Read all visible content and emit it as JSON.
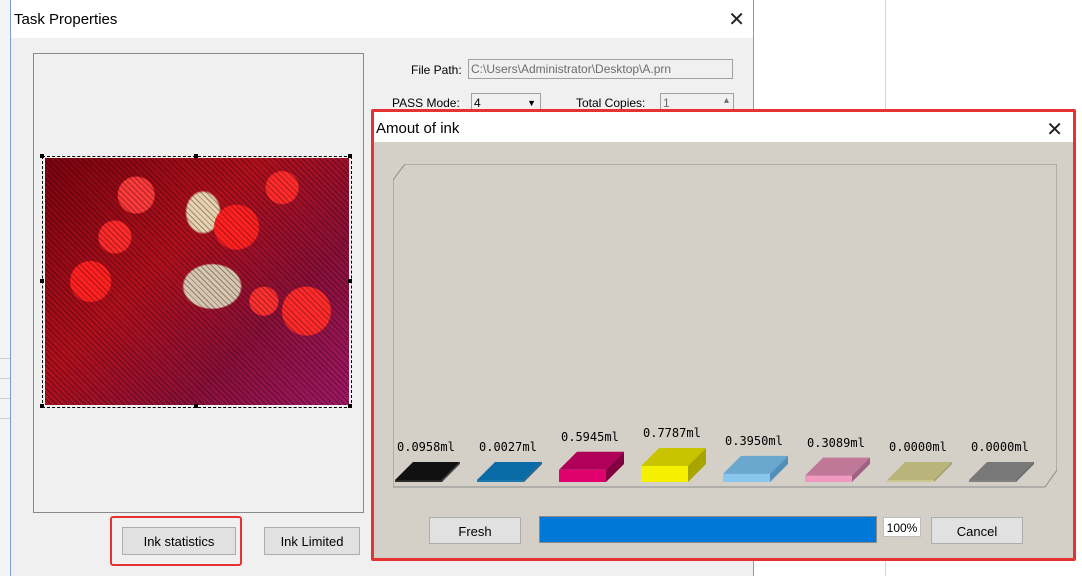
{
  "task_window": {
    "title": "Task Properties",
    "close": "✕",
    "file_path_label": "File Path:",
    "file_path_value": "C:\\Users\\Administrator\\Desktop\\A.prn",
    "pass_mode_label": "PASS Mode:",
    "pass_mode_value": "4",
    "total_copies_label": "Total Copies:",
    "total_copies_value": "1",
    "ink_statistics_button": "Ink statistics",
    "ink_limited_button": "Ink Limited"
  },
  "ink_dialog": {
    "title": "Amout of ink",
    "close": "✕",
    "fresh_button": "Fresh",
    "progress_percent": "100%",
    "progress_value": 1.0,
    "cancel_button": "Cancel"
  },
  "chart_data": {
    "type": "bar",
    "categories": [
      "Black",
      "Cyan",
      "Magenta",
      "Yellow",
      "Light Cyan",
      "Light Magenta",
      "Light Yellow",
      "Gray"
    ],
    "value_labels": [
      "0.0958ml",
      "0.0027ml",
      "0.5945ml",
      "0.7787ml",
      "0.3950ml",
      "0.3089ml",
      "0.0000ml",
      "0.0000ml"
    ],
    "values": [
      0.0958,
      0.0027,
      0.5945,
      0.7787,
      0.395,
      0.3089,
      0.0,
      0.0
    ],
    "colors": [
      {
        "front": "#2a2a2a",
        "top": "#111111",
        "side": "#444444"
      },
      {
        "front": "#1a7ab0",
        "top": "#0a6aa5",
        "side": "#2a5a80"
      },
      {
        "front": "#e0006e",
        "top": "#b0005a",
        "side": "#800040"
      },
      {
        "front": "#f5f000",
        "top": "#c8c400",
        "side": "#a8a400"
      },
      {
        "front": "#88c8ee",
        "top": "#6aa8d0",
        "side": "#5090b8"
      },
      {
        "front": "#f098c0",
        "top": "#c07898",
        "side": "#a06080"
      },
      {
        "front": "#c8c890",
        "top": "#b8b47a",
        "side": "#9e9a68"
      },
      {
        "front": "#808080",
        "top": "#787878",
        "side": "#606060"
      }
    ],
    "unit": "ml"
  }
}
